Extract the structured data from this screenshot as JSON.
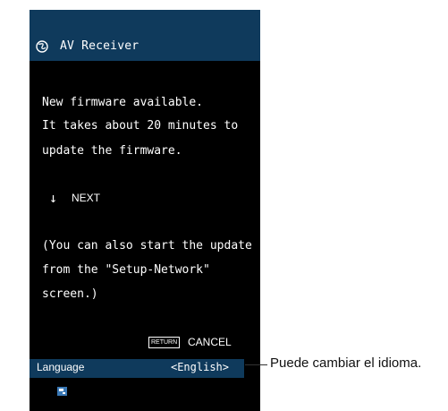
{
  "header": {
    "title": "AV Receiver",
    "icon": "globe-icon"
  },
  "message_lines": [
    "New firmware available.",
    "It takes about 20 minutes to",
    "update the firmware."
  ],
  "next": {
    "arrow": "↓",
    "label": "NEXT"
  },
  "note_lines": [
    "(You can also start the update",
    "from the \"Setup-Network\"",
    "screen.)"
  ],
  "footer": {
    "return_key": "RETURN",
    "cancel_label": "CANCEL"
  },
  "language": {
    "label": "Language",
    "value": "<English>"
  },
  "callout": {
    "text": "Puede cambiar el idioma."
  },
  "colors": {
    "accent_bar": "#0f3a5c",
    "screen_bg": "#000000",
    "text": "#ffffff"
  }
}
